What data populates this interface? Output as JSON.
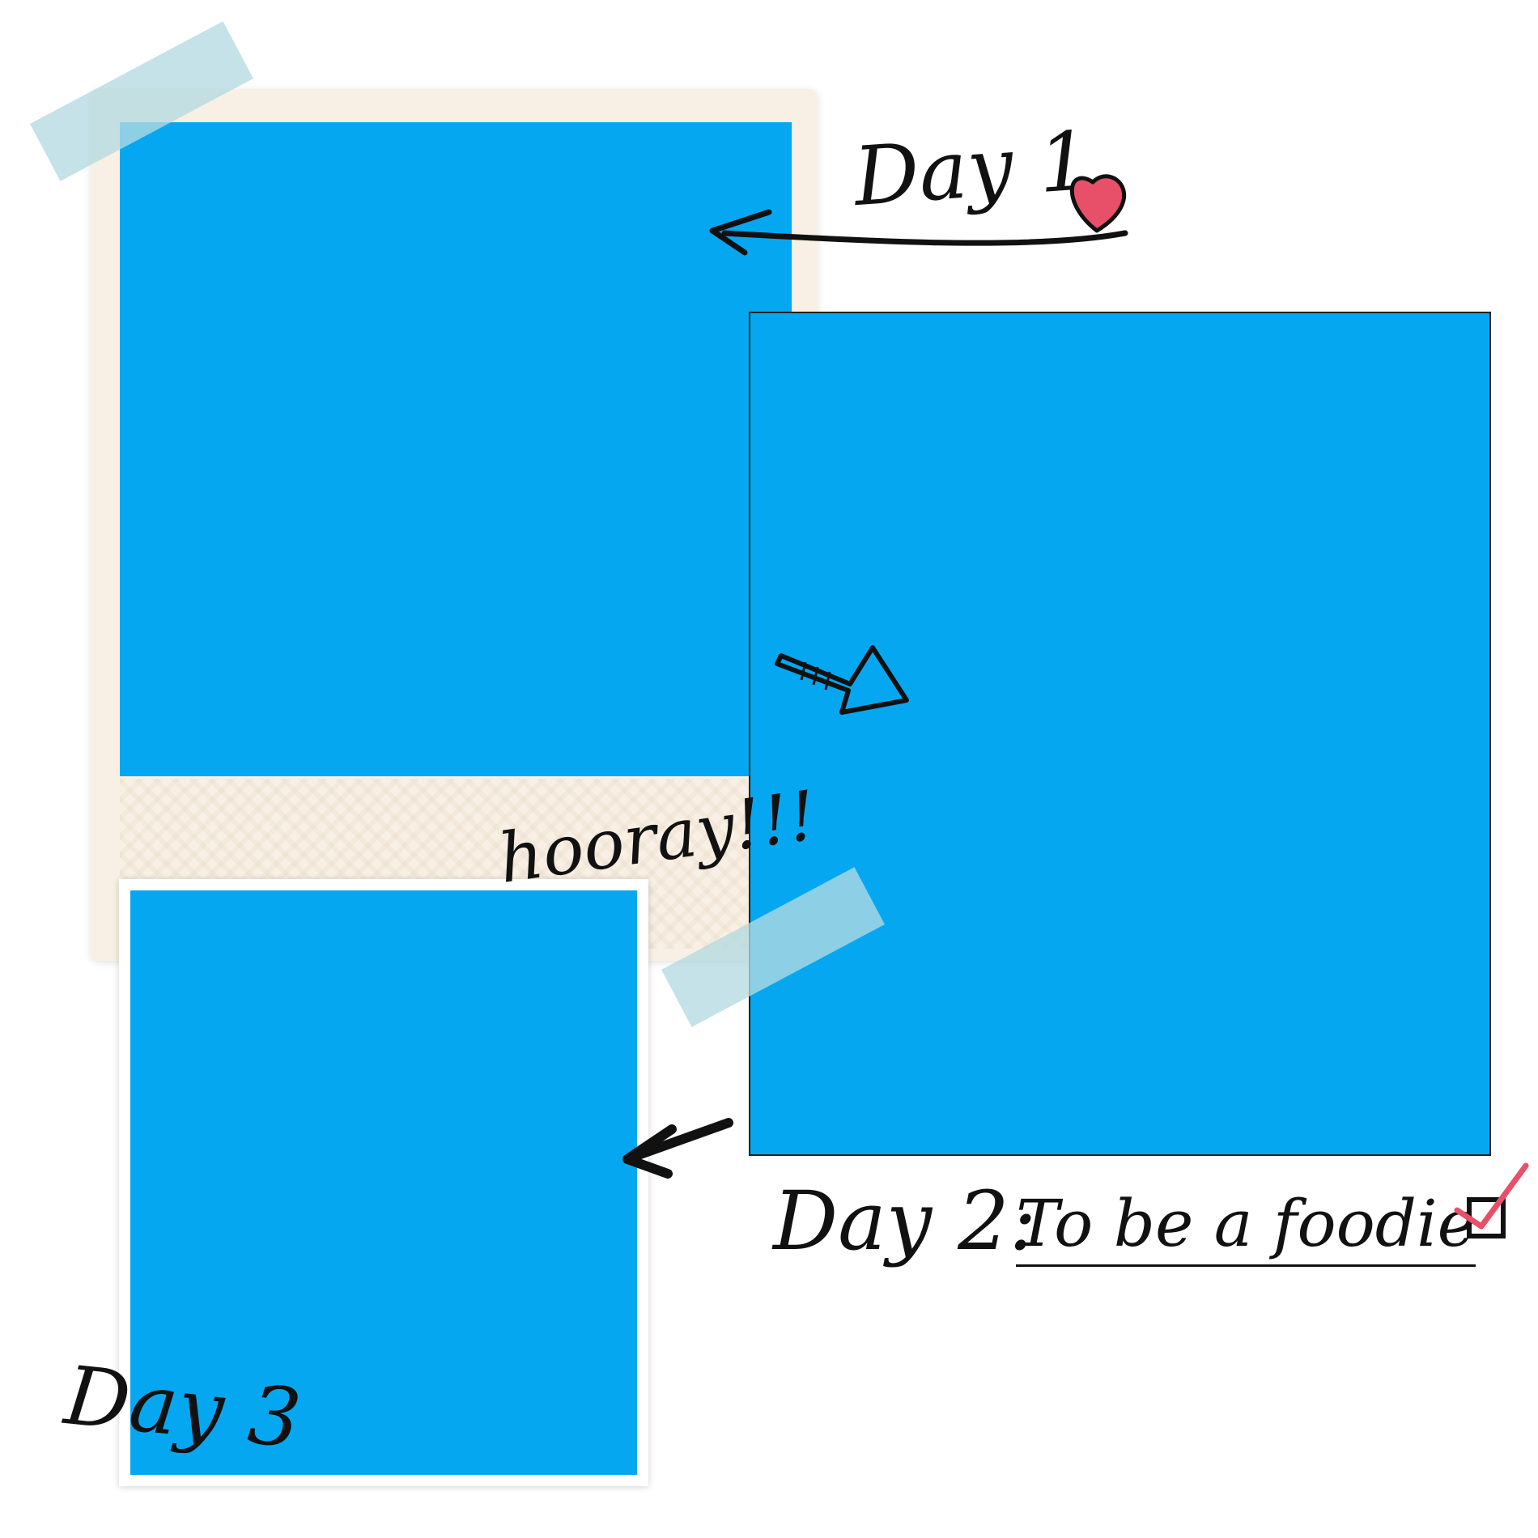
{
  "captions": {
    "day1": "Day 1",
    "hooray": "hooray!!!",
    "day2": "Day 2:",
    "day2_task": "To be a foodie",
    "day3": "Day 3"
  },
  "colors": {
    "photo_placeholder": "#05a8f0",
    "polaroid_frame": "#f8f0e4",
    "tape": "#b4dae2",
    "heart": "#e8506a",
    "checkmark": "#e8506a",
    "ink": "#111111"
  },
  "icons": {
    "heart": "heart-icon",
    "checkbox": "checked-checkbox-icon",
    "arrow_to_day1": "curved-arrow-icon",
    "arrow_to_day2": "block-arrow-icon",
    "arrow_to_day3": "arrow-icon"
  }
}
